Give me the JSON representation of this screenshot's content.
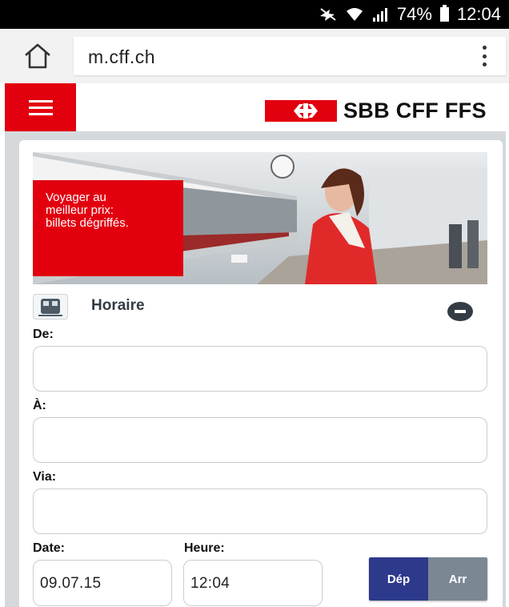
{
  "status_bar": {
    "battery_percent": "74%",
    "time": "12:04"
  },
  "browser": {
    "url": "m.cff.ch"
  },
  "site": {
    "logo_text": "SBB CFF FFS",
    "brand_color": "#e2000f"
  },
  "hero": {
    "text_line1": "Voyager au",
    "text_line2": "meilleur prix:",
    "text_line3": "billets dégriffés."
  },
  "timetable": {
    "title": "Horaire",
    "from_label": "De:",
    "to_label": "À:",
    "via_label": "Via:",
    "date_label": "Date:",
    "time_label": "Heure:",
    "date_value": "09.07.15",
    "time_value": "12:04",
    "departure_label": "Dép",
    "arrival_label": "Arr",
    "active_mode": "Dép"
  }
}
